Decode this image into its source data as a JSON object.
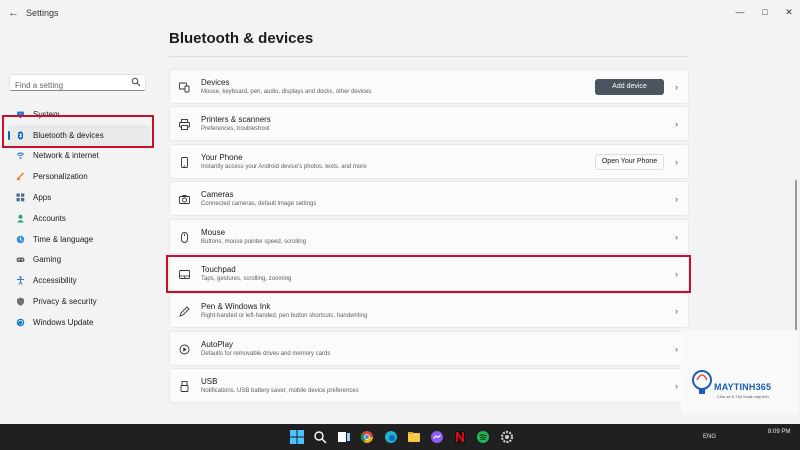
{
  "window": {
    "title": "Settings"
  },
  "search": {
    "placeholder": "Find a setting"
  },
  "sidebar": {
    "items": [
      {
        "label": "System",
        "icon": "monitor-icon",
        "color": "#2d7fd3"
      },
      {
        "label": "Bluetooth & devices",
        "icon": "bluetooth-icon",
        "color": "#0067c0",
        "active": true
      },
      {
        "label": "Network & internet",
        "icon": "wifi-icon",
        "color": "#2d7fd3"
      },
      {
        "label": "Personalization",
        "icon": "brush-icon",
        "color": "#e08a3c"
      },
      {
        "label": "Apps",
        "icon": "apps-icon",
        "color": "#4a6a90"
      },
      {
        "label": "Accounts",
        "icon": "person-icon",
        "color": "#2aa37a"
      },
      {
        "label": "Time & language",
        "icon": "globe-clock-icon",
        "color": "#3b8fd6"
      },
      {
        "label": "Gaming",
        "icon": "gamepad-icon",
        "color": "#606060"
      },
      {
        "label": "Accessibility",
        "icon": "accessibility-icon",
        "color": "#2d7fd3"
      },
      {
        "label": "Privacy & security",
        "icon": "shield-icon",
        "color": "#707070"
      },
      {
        "label": "Windows Update",
        "icon": "update-icon",
        "color": "#0f7ac4"
      }
    ]
  },
  "main": {
    "title": "Bluetooth & devices",
    "cards": [
      {
        "title": "Devices",
        "desc": "Mouse, keyboard, pen, audio, displays and docks, other devices",
        "icon": "devices-icon",
        "button": "Add device",
        "button_style": "primary"
      },
      {
        "title": "Printers & scanners",
        "desc": "Preferences, troubleshoot",
        "icon": "printer-icon"
      },
      {
        "title": "Your Phone",
        "desc": "Instantly access your Android device's photos, texts, and more",
        "icon": "phone-icon",
        "button": "Open Your Phone",
        "button_style": "secondary"
      },
      {
        "title": "Cameras",
        "desc": "Connected cameras, default image settings",
        "icon": "camera-icon"
      },
      {
        "title": "Mouse",
        "desc": "Buttons, mouse pointer speed, scrolling",
        "icon": "mouse-icon"
      },
      {
        "title": "Touchpad",
        "desc": "Taps, gestures, scrolling, zooming",
        "icon": "touchpad-icon",
        "highlighted": true
      },
      {
        "title": "Pen & Windows Ink",
        "desc": "Right-handed or left-handed, pen button shortcuts, handwriting",
        "icon": "pen-icon"
      },
      {
        "title": "AutoPlay",
        "desc": "Defaults for removable drives and memory cards",
        "icon": "autoplay-icon"
      },
      {
        "title": "USB",
        "desc": "Notifications, USB battery saver, mobile device preferences",
        "icon": "usb-icon"
      }
    ]
  },
  "watermark": {
    "brand": "MAYTINH365",
    "tagline": "Chia sẻ & Thủ thuật máy tính"
  },
  "taskbar": {
    "apps": [
      "windows-start-icon",
      "search-icon",
      "task-view-icon",
      "chrome-icon",
      "edge-icon",
      "explorer-icon",
      "messenger-icon",
      "netflix-icon",
      "spotify-icon",
      "settings-icon"
    ],
    "tray": {
      "language": "ENG",
      "time": "8:09 PM"
    }
  },
  "colors": {
    "accent": "#0067c0",
    "highlight": "#c8102e",
    "primary_button": "#4a5560",
    "taskbar": "#202020"
  }
}
